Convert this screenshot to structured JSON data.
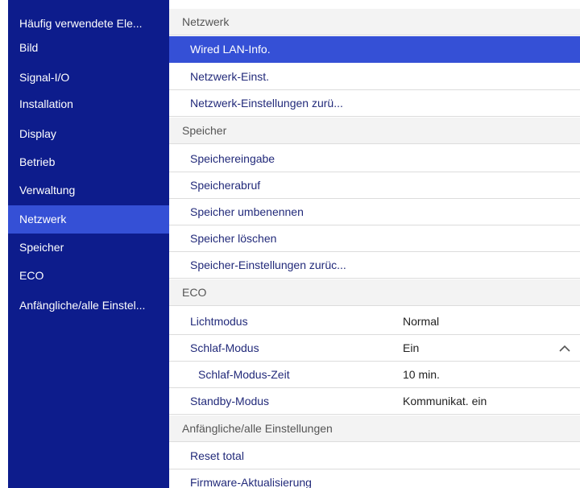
{
  "sidebar": {
    "items": [
      {
        "label": "Häufig verwendete Ele..."
      },
      {
        "label": "Bild"
      },
      {
        "label": "Signal-I/O"
      },
      {
        "label": "Installation"
      },
      {
        "label": "Display"
      },
      {
        "label": "Betrieb"
      },
      {
        "label": "Verwaltung"
      },
      {
        "label": "Netzwerk",
        "active": true
      },
      {
        "label": "Speicher"
      },
      {
        "label": "ECO"
      },
      {
        "label": "Anfängliche/alle Einstel..."
      }
    ]
  },
  "main": {
    "netzwerk": {
      "header": "Netzwerk",
      "items": [
        "Wired LAN-Info.",
        "Netzwerk-Einst.",
        "Netzwerk-Einstellungen zurü..."
      ]
    },
    "speicher": {
      "header": "Speicher",
      "items": [
        "Speichereingabe",
        "Speicherabruf",
        "Speicher umbenennen",
        "Speicher löschen",
        "Speicher-Einstellungen zurüc..."
      ]
    },
    "eco": {
      "header": "ECO",
      "lichtmodus": {
        "label": "Lichtmodus",
        "value": "Normal"
      },
      "schlaf_modus": {
        "label": "Schlaf-Modus",
        "value": "Ein"
      },
      "schlaf_modus_zeit": {
        "label": "Schlaf-Modus-Zeit",
        "value": "10 min."
      },
      "standby_modus": {
        "label": "Standby-Modus",
        "value": "Kommunikat. ein"
      }
    },
    "anfaengliche": {
      "header": "Anfängliche/alle Einstellungen",
      "items": [
        "Reset total",
        "Firmware-Aktualisierung"
      ]
    }
  },
  "icons": {
    "collapse": "chevron-up-icon"
  },
  "colors": {
    "sidebar_bg": "#0d1c8c",
    "accent": "#3550d6"
  }
}
